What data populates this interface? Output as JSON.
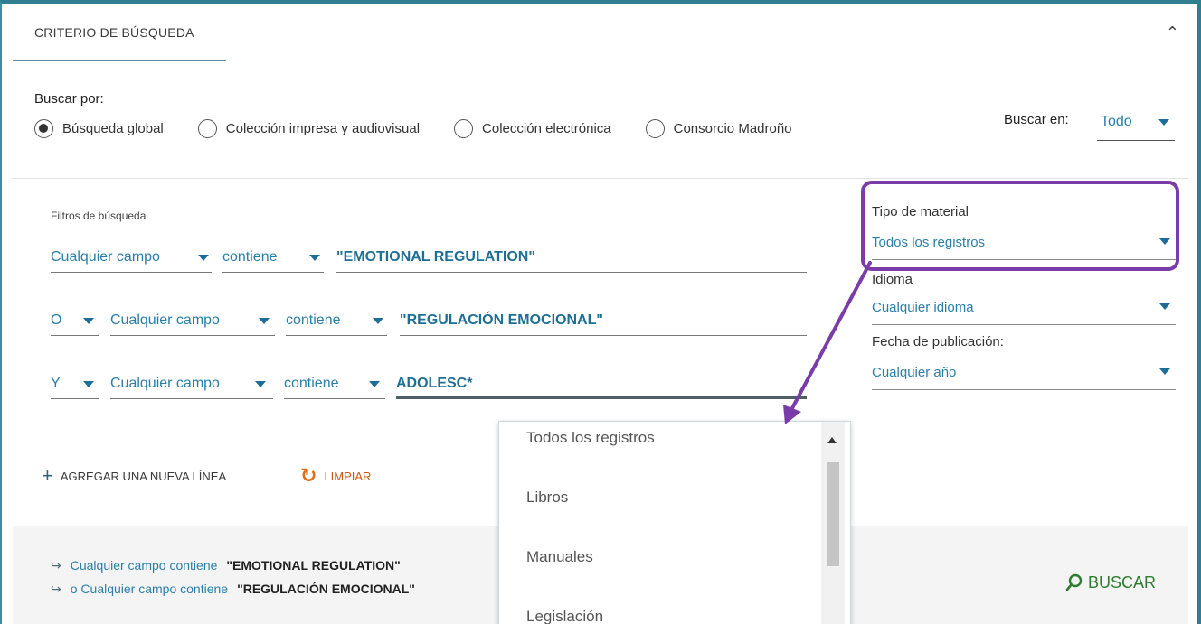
{
  "panel": {
    "tab_label": "CRITERIO DE BÚSQUEDA",
    "collapse_icon": "chevron-up-icon"
  },
  "scope": {
    "label": "Buscar por:",
    "options": [
      "Búsqueda global",
      "Colección impresa y audiovisual",
      "Colección electrónica",
      "Consorcio Madroño"
    ],
    "selected": "Búsqueda global"
  },
  "buscar_en": {
    "label": "Buscar en:",
    "value": "Todo"
  },
  "filters": {
    "label": "Filtros de búsqueda",
    "rows": [
      {
        "operator": "",
        "field": "Cualquier campo",
        "condition": "contiene",
        "term": "\"EMOTIONAL REGULATION\""
      },
      {
        "operator": "O",
        "field": "Cualquier campo",
        "condition": "contiene",
        "term": "\"REGULACIÓN EMOCIONAL\""
      },
      {
        "operator": "Y",
        "field": "Cualquier campo",
        "condition": "contiene",
        "term": "ADOLESC*"
      }
    ]
  },
  "actions": {
    "add_line": "AGREGAR UNA NUEVA LÍNEA",
    "clear": "LIMPIAR",
    "search": "BUSCAR"
  },
  "side": {
    "material_label": "Tipo de material",
    "material_value": "Todos los registros",
    "language_label": "Idioma",
    "language_value": "Cualquier idioma",
    "date_label": "Fecha de publicación:",
    "date_value": "Cualquier año"
  },
  "dropdown": {
    "options": [
      "Todos los registros",
      "Libros",
      "Manuales",
      "Legislación"
    ]
  },
  "query_summary": {
    "line1": {
      "op": "",
      "text": "Cualquier campo contiene",
      "term": "\"EMOTIONAL REGULATION\""
    },
    "line2": {
      "op": "o",
      "text": "Cualquier campo contiene",
      "term": "\"REGULACIÓN EMOCIONAL\""
    }
  },
  "colors": {
    "accent": "#2a7fa8",
    "highlight": "#7a3ca8",
    "search": "#2e7d2e",
    "clear": "#c9581d"
  }
}
